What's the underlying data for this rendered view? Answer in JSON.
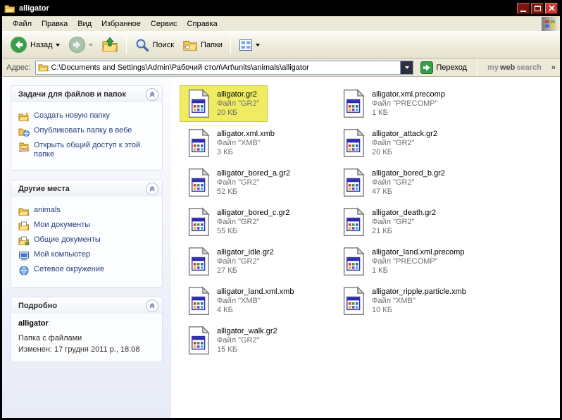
{
  "window": {
    "title": "alligator"
  },
  "colors": {
    "titlebar": "#000000",
    "chrome": "#ece9d8",
    "selection_yellow": "#efec62",
    "accent_green": "#2c8a3c",
    "link_navy": "#26417e"
  },
  "menu": {
    "items": [
      "Файл",
      "Правка",
      "Вид",
      "Избранное",
      "Сервис",
      "Справка"
    ]
  },
  "toolbar": {
    "back_label": "Назад",
    "search_label": "Поиск",
    "folders_label": "Папки"
  },
  "address": {
    "label": "Адрес:",
    "value": "C:\\Documents and Settings\\Admin\\Рабочий стол\\Art\\units\\animals\\alligator",
    "go_label": "Переход",
    "websearch_my": "my",
    "websearch_web": "web",
    "websearch_search": "search",
    "overflow_chevron": "»"
  },
  "sidebar": {
    "tasks": {
      "title": "Задачи для файлов и папок",
      "items": [
        "Создать новую папку",
        "Опубликовать папку в вебе",
        "Открыть общий доступ к этой папке"
      ]
    },
    "places": {
      "title": "Другие места",
      "items": [
        "animals",
        "Мои документы",
        "Общие документы",
        "Мой компьютер",
        "Сетевое окружение"
      ]
    },
    "details": {
      "title": "Подробно",
      "name": "alligator",
      "type": "Папка с файлами",
      "modified": "Изменен: 17 грудня 2011 р., 18:08"
    }
  },
  "icons": {
    "window-icon": "open-yellow-folder",
    "back-icon": "green-circle-left-arrow",
    "forward-icon": "green-circle-right-arrow-disabled",
    "up-icon": "folder-with-green-up-arrow",
    "search-icon": "magnifier",
    "folders-icon": "yellow-folder-pane",
    "views-icon": "tile-grid",
    "go-icon": "green-right-arrow",
    "file-icon": "generic-program-file-page",
    "windows-logo": "four-color-flag"
  },
  "files": [
    {
      "name": "alligator.gr2",
      "type": "Файл \"GR2\"",
      "size": "20 КБ",
      "selected": true
    },
    {
      "name": "alligator.xml.precomp",
      "type": "Файл \"PRECOMP\"",
      "size": "1 КБ",
      "selected": false
    },
    {
      "name": "alligator.xml.xmb",
      "type": "Файл \"XMB\"",
      "size": "3 КБ",
      "selected": false
    },
    {
      "name": "alligator_attack.gr2",
      "type": "Файл \"GR2\"",
      "size": "20 КБ",
      "selected": false
    },
    {
      "name": "alligator_bored_a.gr2",
      "type": "Файл \"GR2\"",
      "size": "52 КБ",
      "selected": false
    },
    {
      "name": "alligator_bored_b.gr2",
      "type": "Файл \"GR2\"",
      "size": "47 КБ",
      "selected": false
    },
    {
      "name": "alligator_bored_c.gr2",
      "type": "Файл \"GR2\"",
      "size": "55 КБ",
      "selected": false
    },
    {
      "name": "alligator_death.gr2",
      "type": "Файл \"GR2\"",
      "size": "21 КБ",
      "selected": false
    },
    {
      "name": "alligator_idle.gr2",
      "type": "Файл \"GR2\"",
      "size": "27 КБ",
      "selected": false
    },
    {
      "name": "alligator_land.xml.precomp",
      "type": "Файл \"PRECOMP\"",
      "size": "1 КБ",
      "selected": false
    },
    {
      "name": "alligator_land.xml.xmb",
      "type": "Файл \"XMB\"",
      "size": "4 КБ",
      "selected": false
    },
    {
      "name": "alligator_ripple.particle.xmb",
      "type": "Файл \"XMB\"",
      "size": "10 КБ",
      "selected": false
    },
    {
      "name": "alligator_walk.gr2",
      "type": "Файл \"GR2\"",
      "size": "15 КБ",
      "selected": false
    }
  ]
}
